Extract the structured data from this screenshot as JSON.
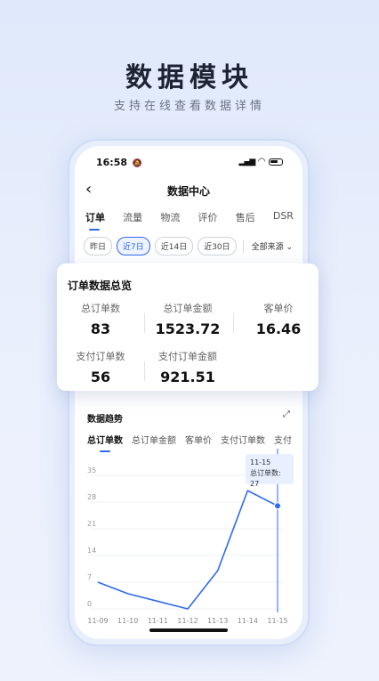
{
  "hero": {
    "title": "数据模块",
    "subtitle": "支持在线查看数据详情"
  },
  "status_bar": {
    "time": "16:58",
    "mute_icon": "bell-slash-icon",
    "signal": "signal-icon",
    "wifi": "wifi-icon",
    "battery": "battery-icon"
  },
  "nav": {
    "back_icon": "chevron-left-icon",
    "title": "数据中心"
  },
  "tabs": [
    "订单",
    "流量",
    "物流",
    "评价",
    "售后",
    "DSR"
  ],
  "active_tab": 0,
  "date_chips": [
    "昨日",
    "近7日",
    "近14日",
    "近30日"
  ],
  "active_chip": 1,
  "source_label": "全部来源",
  "overview": {
    "title": "订单数据总览",
    "metrics": [
      {
        "label": "总订单数",
        "value": "83"
      },
      {
        "label": "总订单金额",
        "value": "1523.72"
      },
      {
        "label": "客单价",
        "value": "16.46"
      },
      {
        "label": "支付订单数",
        "value": "56"
      },
      {
        "label": "支付订单金额",
        "value": "921.51"
      }
    ]
  },
  "trend": {
    "title": "数据趋势",
    "expand_icon": "expand-icon",
    "tabs": [
      "总订单数",
      "总订单金额",
      "客单价",
      "支付订单数",
      "支付"
    ],
    "active_tab": 0,
    "tooltip": {
      "date": "11-15",
      "text": "总订单数: 27"
    }
  },
  "chart_data": {
    "type": "line",
    "x": [
      "11-09",
      "11-10",
      "11-11",
      "11-12",
      "11-13",
      "11-14",
      "11-15"
    ],
    "series": [
      {
        "values": [
          7,
          4,
          2,
          0,
          10,
          31,
          27
        ]
      }
    ],
    "ylim": [
      0,
      35
    ],
    "yticks": [
      "0",
      "7",
      "14",
      "21",
      "28",
      "35"
    ],
    "line_color": "#2f6bf0",
    "highlight_index": 6
  }
}
